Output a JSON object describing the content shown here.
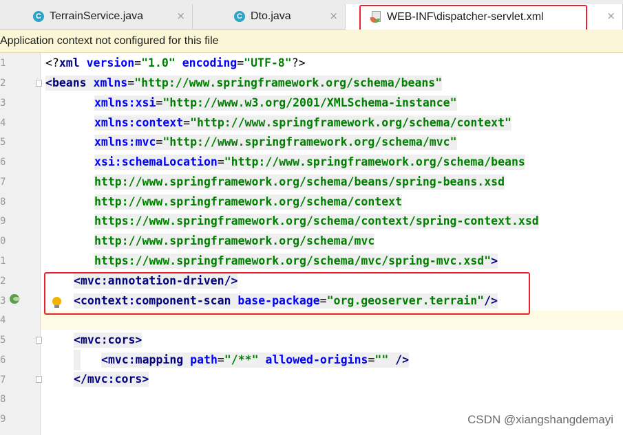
{
  "tabs": [
    {
      "label": "TerrainService.java",
      "icon": "C",
      "close": "×"
    },
    {
      "label": "Dto.java",
      "icon": "C",
      "close": "×"
    },
    {
      "label": "WEB-INF\\dispatcher-servlet.xml",
      "icon": "xml-file",
      "close": "×"
    }
  ],
  "banner": {
    "text": "Application context not configured for this file"
  },
  "line_numbers": [
    "1",
    "2",
    "3",
    "4",
    "5",
    "6",
    "7",
    "8",
    "9",
    "0",
    "1",
    "2",
    "3",
    "4",
    "5",
    "6",
    "7",
    "8",
    "9"
  ],
  "code": {
    "l1": {
      "a": "<?",
      "b": "xml ",
      "c": "version",
      "d": "=",
      "e": "\"1.0\"",
      "f": " ",
      "g": "encoding",
      "h": "=",
      "i": "\"UTF-8\"",
      "j": "?>"
    },
    "l2": {
      "a": "<",
      "b": "beans ",
      "c": "xmlns",
      "d": "=",
      "e": "\"http://www.springframework.org/schema/beans\""
    },
    "l3": {
      "a": "xmlns:xsi",
      "b": "=",
      "c": "\"http://www.w3.org/2001/XMLSchema-instance\""
    },
    "l4": {
      "a": "xmlns:context",
      "b": "=",
      "c": "\"http://www.springframework.org/schema/context\""
    },
    "l5": {
      "a": "xmlns:mvc",
      "b": "=",
      "c": "\"http://www.springframework.org/schema/mvc\""
    },
    "l6": {
      "a": "xsi:schemaLocation",
      "b": "=",
      "c": "\"http://www.springframework.org/schema/beans"
    },
    "l7": {
      "a": "http://www.springframework.org/schema/beans/spring-beans.xsd"
    },
    "l8": {
      "a": "http://www.springframework.org/schema/context"
    },
    "l9": {
      "a": "https://www.springframework.org/schema/context/spring-context.xsd"
    },
    "l10": {
      "a": "http://www.springframework.org/schema/mvc"
    },
    "l11": {
      "a": "https://www.springframework.org/schema/mvc/spring-mvc.xsd\"",
      "b": ">"
    },
    "l12": {
      "a": "<",
      "b": "mvc:annotation-driven",
      "c": "/>"
    },
    "l13": {
      "a": "<",
      "b": "context:component-scan ",
      "c": "base-package",
      "d": "=",
      "e": "\"org.geoserver.terrain\"",
      "f": "/>"
    },
    "l15": {
      "a": "<",
      "b": "mvc:cors",
      "c": ">"
    },
    "l16": {
      "a": "<",
      "b": "mvc:mapping ",
      "c": "path",
      "d": "=",
      "e": "\"/**\"",
      "f": " ",
      "g": "allowed-origins",
      "h": "=",
      "i": "\"\"",
      "j": " />"
    },
    "l17": {
      "a": "</",
      "b": "mvc:cors",
      "c": ">"
    }
  },
  "watermark": "CSDN @xiangshangdemayi",
  "colors": {
    "tag": "#000080",
    "attribute": "#0000ff",
    "value": "#008000",
    "annotation_box": "#e8232e",
    "banner_bg": "#fbf6d6"
  }
}
